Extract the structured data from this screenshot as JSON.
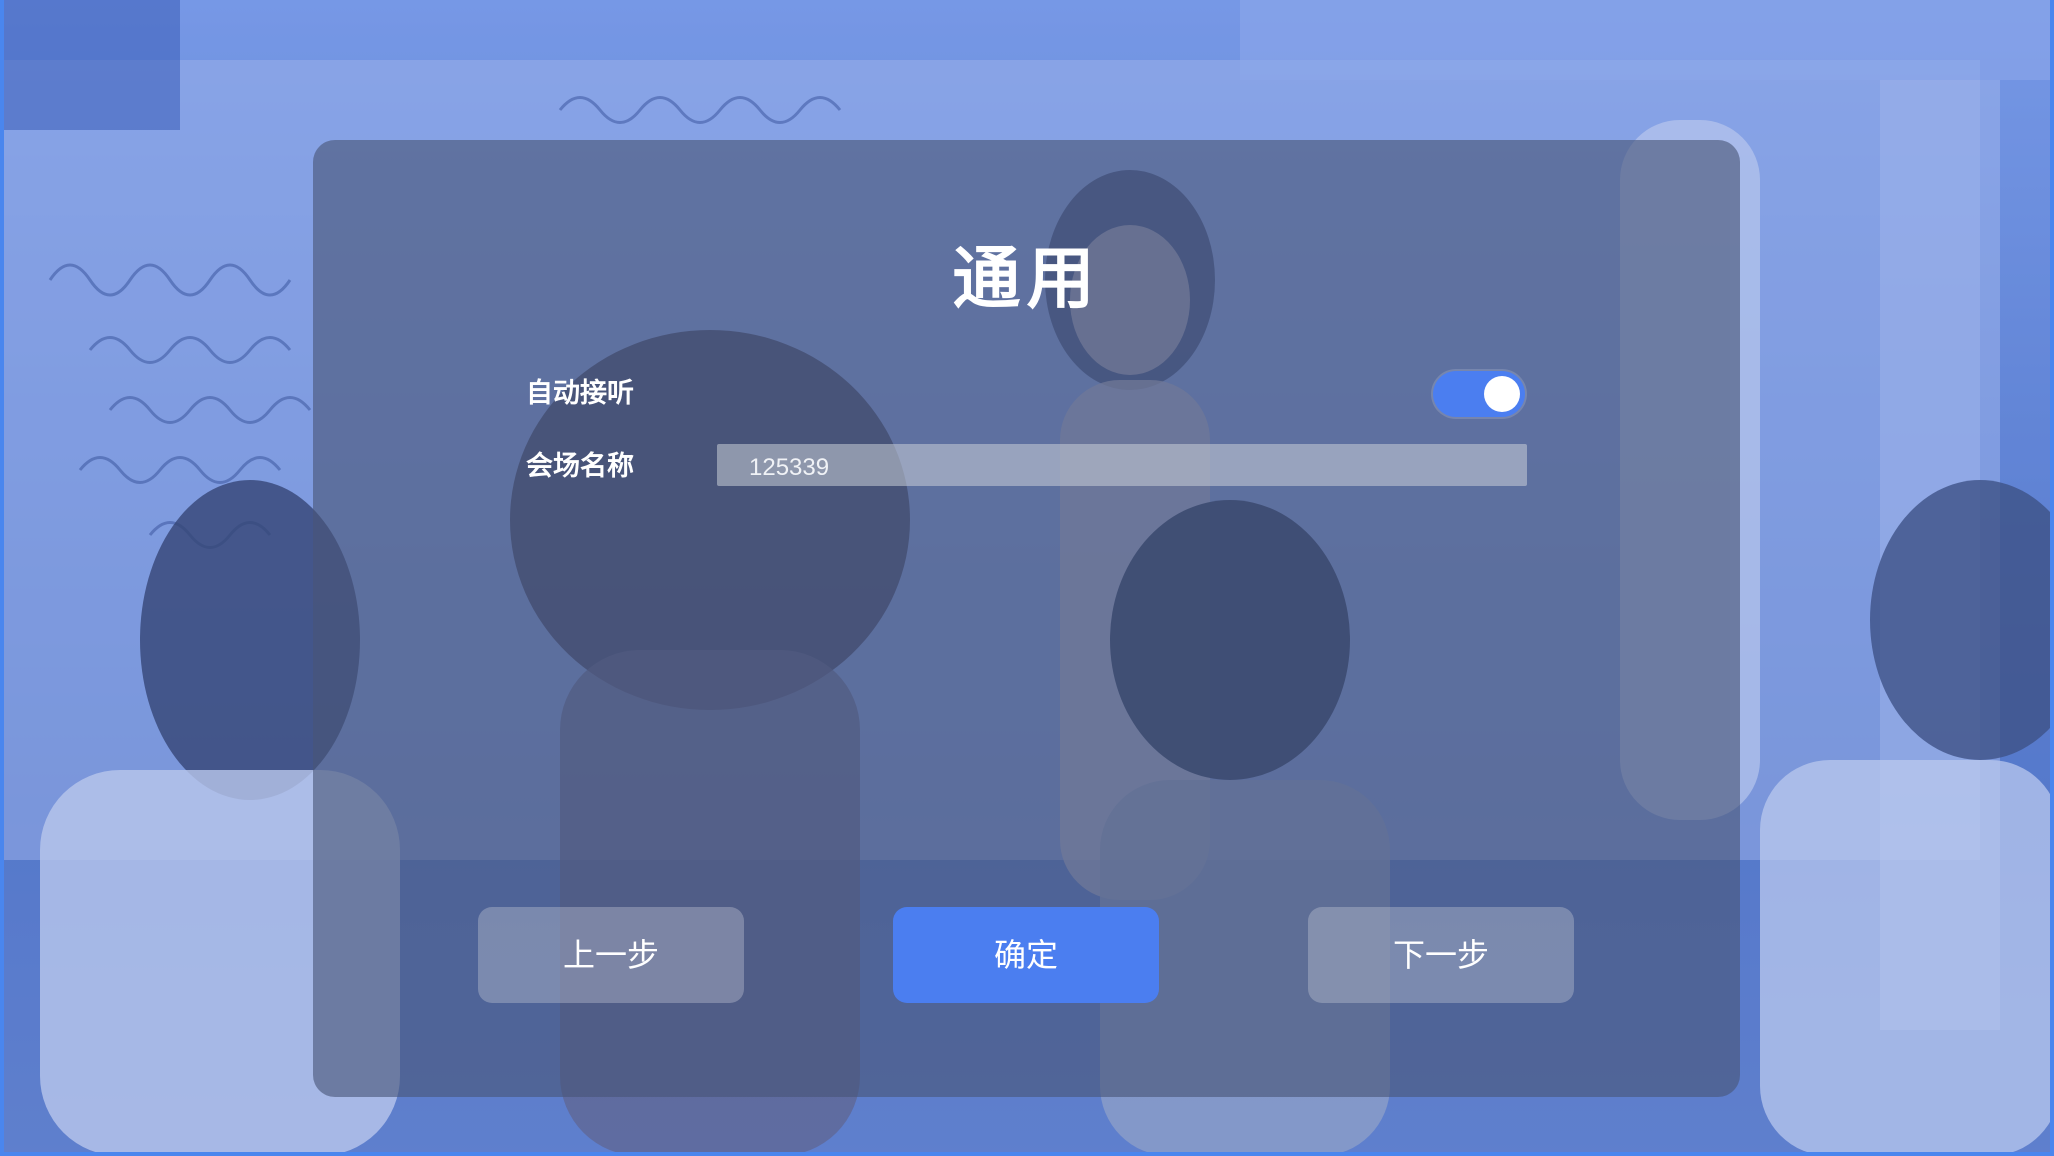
{
  "dialog": {
    "title": "通用",
    "auto_answer_label": "自动接听",
    "auto_answer_enabled": true,
    "venue_name_label": "会场名称",
    "venue_name_value": "125339"
  },
  "buttons": {
    "prev_label": "上一步",
    "confirm_label": "确定",
    "next_label": "下一步"
  },
  "colors": {
    "accent": "#4b7ef0",
    "dialog_overlay": "#485678"
  }
}
